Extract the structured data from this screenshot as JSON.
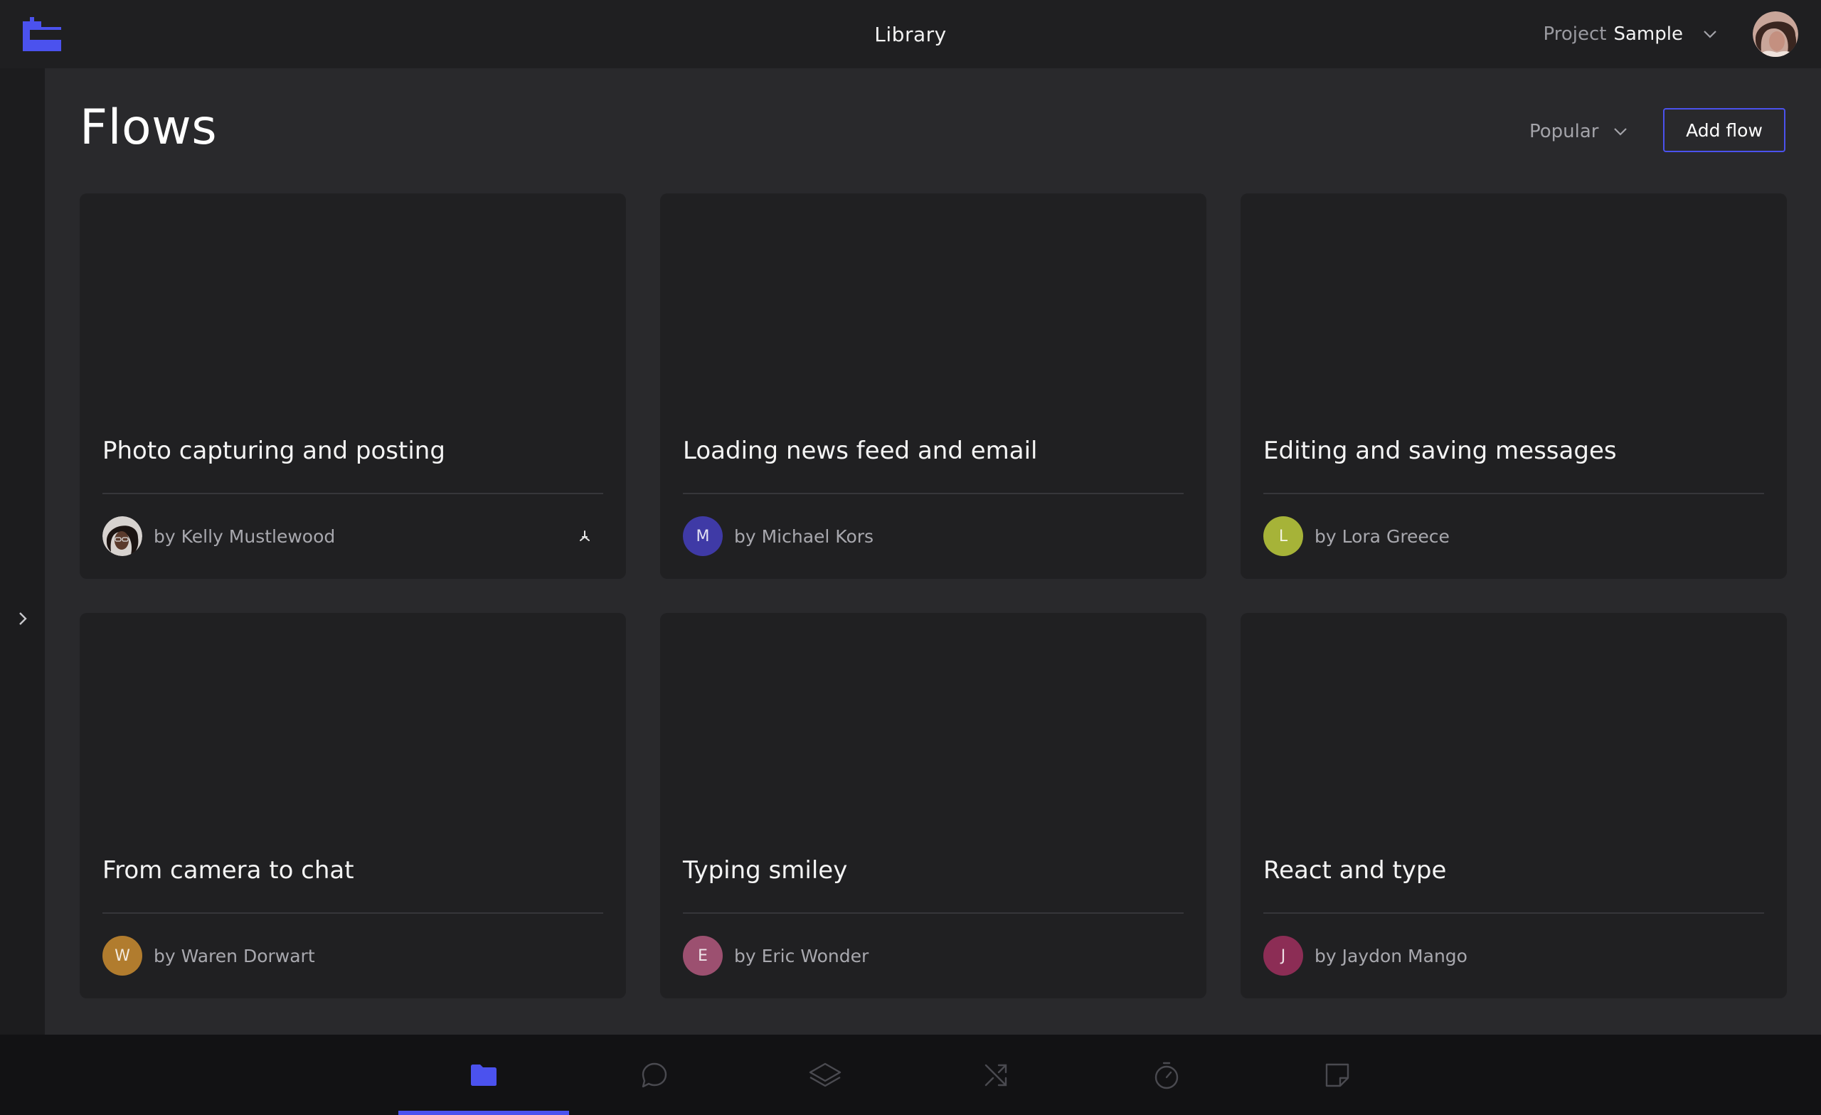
{
  "header": {
    "title": "Library",
    "project_label": "Project",
    "project_value": "Sample"
  },
  "page": {
    "title": "Flows",
    "sort_label": "Popular",
    "add_button": "Add flow"
  },
  "cards": [
    {
      "title": "Photo capturing and posting",
      "author": "by Kelly Mustlewood",
      "initial": "",
      "avatar_type": "photo",
      "has_action": true
    },
    {
      "title": "Loading news feed and email",
      "author": "by Michael Kors",
      "initial": "M",
      "avatar_color": "#3f3aa6"
    },
    {
      "title": "Editing and saving messages",
      "author": "by Lora Greece",
      "initial": "L",
      "avatar_color": "#a6b338"
    },
    {
      "title": "From camera to chat",
      "author": "by Waren Dorwart",
      "initial": "W",
      "avatar_color": "#b17c2e"
    },
    {
      "title": "Typing smiley",
      "author": "by Eric Wonder",
      "initial": "E",
      "avatar_color": "#9c5070"
    },
    {
      "title": "React and type",
      "author": "by Jaydon Mango",
      "initial": "J",
      "avatar_color": "#8c2d55"
    }
  ],
  "bottom_nav": [
    {
      "icon": "folder-icon",
      "active": true
    },
    {
      "icon": "chat-bubble-icon",
      "active": false
    },
    {
      "icon": "layers-icon",
      "active": false
    },
    {
      "icon": "shuffle-icon",
      "active": false
    },
    {
      "icon": "stopwatch-icon",
      "active": false
    },
    {
      "icon": "sticky-note-icon",
      "active": false
    }
  ],
  "colors": {
    "accent": "#4b52ee",
    "background": "#29292c",
    "card": "#202022",
    "topbar": "#1f1f21",
    "bottombar": "#121214"
  }
}
